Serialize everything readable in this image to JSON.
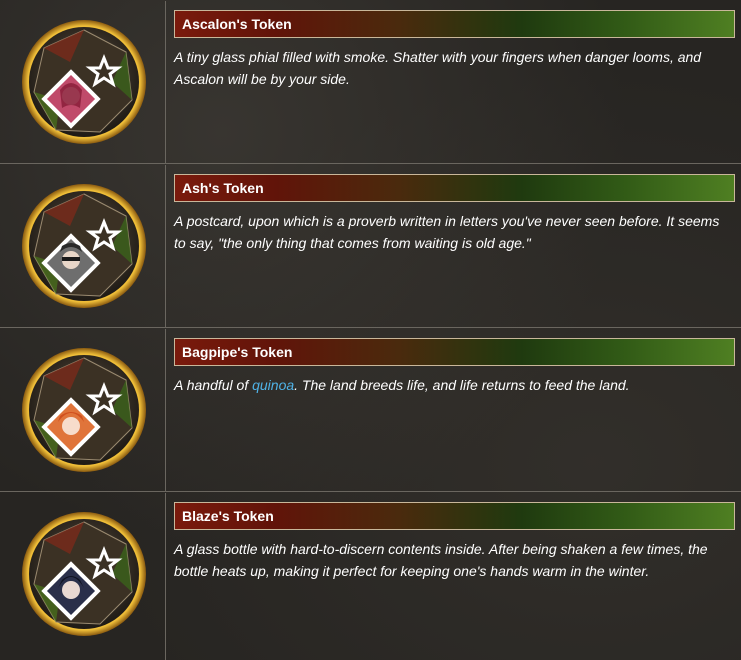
{
  "tokens": [
    {
      "title": "Ascalon's Token",
      "description": "A tiny glass phial filled with smoke. Shatter with your fingers when danger looms, and Ascalon will be by your side.",
      "portrait_color": "#c04a6a"
    },
    {
      "title": "Ash's Token",
      "description": "A postcard, upon which is a proverb written in letters you've never seen before. It seems to say, \"the only thing that comes from waiting is old age.\"",
      "portrait_color": "#7a7a7a"
    },
    {
      "title": "Bagpipe's Token",
      "description_before": "A handful of ",
      "description_link": "quinoa",
      "description_after": ". The land breeds life, and life returns to feed the land.",
      "portrait_color": "#e0743a"
    },
    {
      "title": "Blaze's Token",
      "description": "A glass bottle with hard-to-discern contents inside. After being shaken a few times, the bottle heats up, making it perfect for keeping one's hands warm in the winter.",
      "portrait_color": "#2a2f4a"
    }
  ],
  "colors": {
    "title_gradient_start": "#7a1a0c",
    "title_gradient_end": "#4f7f22",
    "link": "#4fb2e6",
    "medal_ring": "#e0a62a"
  },
  "icons": {
    "medal": "token-medal-icon",
    "star": "rhodes-star-icon"
  }
}
